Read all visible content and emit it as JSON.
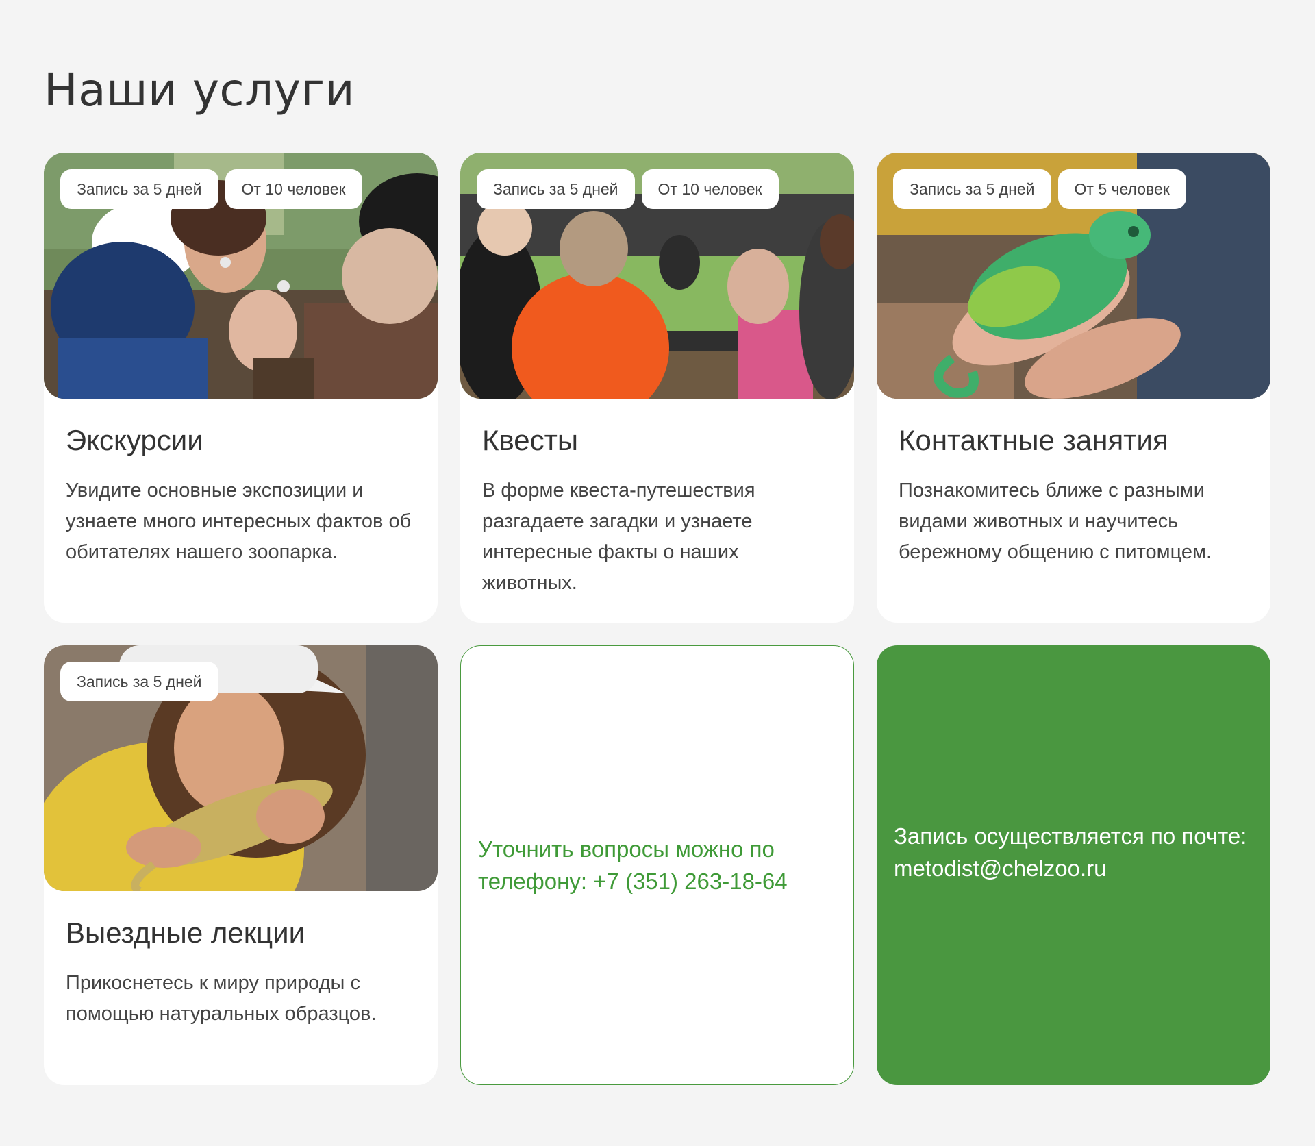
{
  "page": {
    "title": "Наши услуги"
  },
  "services": [
    {
      "title": "Экскурсии",
      "description": "Увидите основные экспозиции и узнаете много интересных фактов об обитателях нашего зоопарка.",
      "tags": [
        "Запись за 5 дней",
        "От 10 человек"
      ],
      "image": "children-with-guide-photo"
    },
    {
      "title": "Квесты",
      "description": "В форме квеста-путешествия разгадаете загадки и узнаете интересные факты о наших животных.",
      "tags": [
        "Запись за 5 дней",
        "От 10 человек"
      ],
      "image": "children-at-enclosure-photo"
    },
    {
      "title": "Контактные занятия",
      "description": "Познакомитесь ближе с разными видами животных и научитесь бережному общению с питомцем.",
      "tags": [
        "Запись за 5 дней",
        "От 5 человек"
      ],
      "image": "chameleon-on-hand-photo"
    },
    {
      "title": "Выездные лекции",
      "description": "Прикоснетесь к миру природы с помощью натуральных образцов.",
      "tags": [
        "Запись за 5 дней"
      ],
      "image": "girl-holding-lizard-photo"
    }
  ],
  "info": {
    "phone_text": "Уточнить вопросы можно по телефону: +7 (351) 263-18-64",
    "email_text": "Запись осуществляется по почте: metodist@chelzoo.ru"
  },
  "colors": {
    "background": "#f4f4f4",
    "card": "#ffffff",
    "accent_green": "#4a9740",
    "text": "#333333"
  }
}
